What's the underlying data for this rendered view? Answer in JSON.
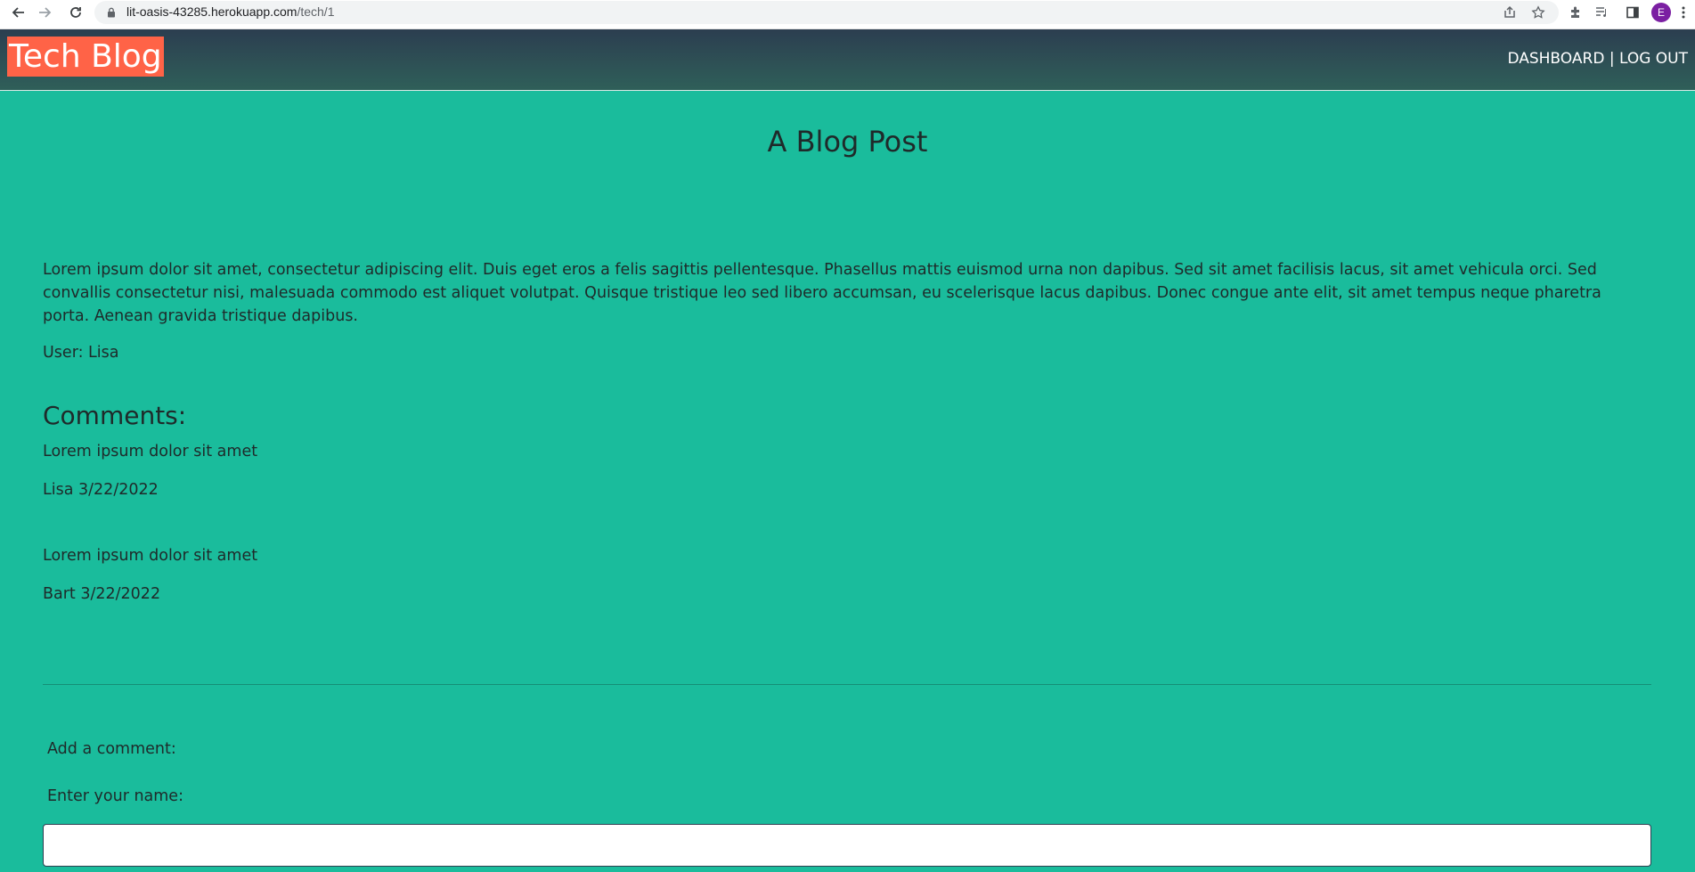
{
  "browser": {
    "url_domain": "lit-oasis-43285.herokuapp.com",
    "url_path": "/tech/1",
    "avatar_initial": "E",
    "icons": [
      "back-icon",
      "forward-icon",
      "reload-icon",
      "lock-icon",
      "share-icon",
      "bookmark-star-icon",
      "extensions-icon",
      "media-icon",
      "side-panel-icon",
      "menu-icon"
    ]
  },
  "header": {
    "brand": "Tech Blog",
    "nav": {
      "dashboard": "DASHBOARD",
      "separator": " | ",
      "logout": "LOG OUT"
    }
  },
  "post": {
    "title": "A Blog Post",
    "body": "Lorem ipsum dolor sit amet, consectetur adipiscing elit. Duis eget eros a felis sagittis pellentesque. Phasellus mattis euismod urna non dapibus. Sed sit amet facilisis lacus, sit amet vehicula orci. Sed convallis consectetur nisi, malesuada commodo est aliquet volutpat. Quisque tristique leo sed libero accumsan, eu scelerisque lacus dapibus. Donec congue ante elit, sit amet tempus neque pharetra porta. Aenean gravida tristique dapibus.",
    "user": "User: Lisa"
  },
  "comments": {
    "heading": "Comments:",
    "items": [
      {
        "text": "Lorem ipsum dolor sit amet",
        "meta": "Lisa 3/22/2022"
      },
      {
        "text": "Lorem ipsum dolor sit amet",
        "meta": "Bart 3/22/2022"
      }
    ]
  },
  "comment_form": {
    "title": "Add a comment:",
    "name_label": "Enter your name:",
    "name_value": ""
  },
  "colors": {
    "page_background": "#1abc9c",
    "header_background": "#2c3e50",
    "brand_background": "#ff6347"
  }
}
